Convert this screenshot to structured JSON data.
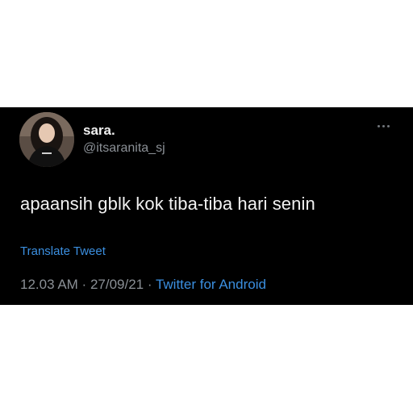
{
  "tweet": {
    "display_name": "sara.",
    "handle": "@itsaranita_sj",
    "text": "apaansih gblk kok tiba-tiba hari senin",
    "translate_label": "Translate Tweet",
    "time": "12.03 AM",
    "sep1": " · ",
    "date": "27/09/21",
    "sep2": " · ",
    "source": "Twitter for Android",
    "avatar_icon": "profile-photo",
    "more_icon": "more-horizontal-icon"
  },
  "colors": {
    "background": "#000000",
    "link": "#3b8fe0",
    "secondary_text": "#8b9096",
    "primary_text": "#f2f2f2"
  }
}
